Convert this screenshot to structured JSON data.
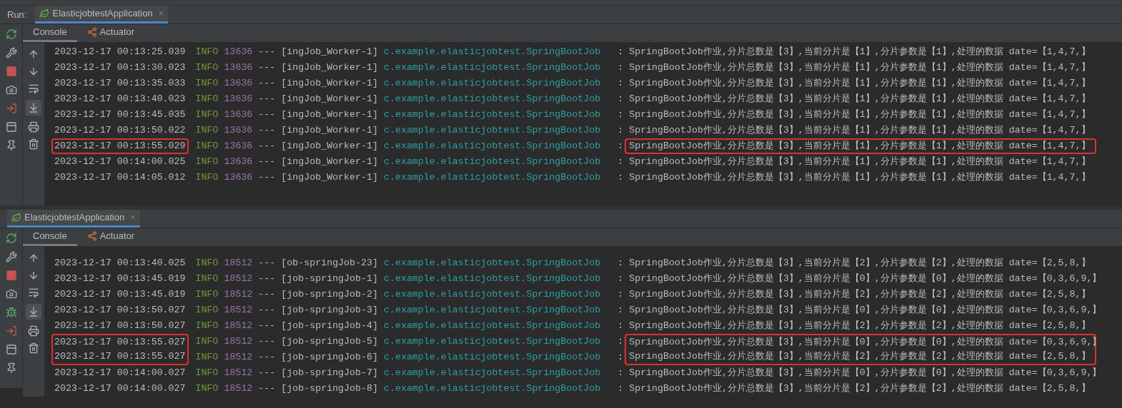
{
  "panels": [
    {
      "run_label": "Run:",
      "tab": {
        "title": "ElasticjobtestApplication",
        "close": "×",
        "selected": true
      },
      "subtabs": [
        {
          "label": "Console",
          "selected": true
        },
        {
          "label": "Actuator",
          "selected": false
        }
      ],
      "scroll_to_end": true,
      "rows": [
        {
          "time": "2023-12-17 00:13:25.039",
          "level": "INFO",
          "pid": "13636",
          "dashes": "---",
          "thread": "[ingJob_Worker-1]",
          "logger": "c.example.elasticjobtest.SpringBootJob",
          "sep": ":",
          "message": "SpringBootJob作业,分片总数是【3】,当前分片是【1】,分片参数是【1】,处理的数据 date=【1,4,7,】",
          "highlight": false
        },
        {
          "time": "2023-12-17 00:13:30.023",
          "level": "INFO",
          "pid": "13636",
          "dashes": "---",
          "thread": "[ingJob_Worker-1]",
          "logger": "c.example.elasticjobtest.SpringBootJob",
          "sep": ":",
          "message": "SpringBootJob作业,分片总数是【3】,当前分片是【1】,分片参数是【1】,处理的数据 date=【1,4,7,】",
          "highlight": false
        },
        {
          "time": "2023-12-17 00:13:35.033",
          "level": "INFO",
          "pid": "13636",
          "dashes": "---",
          "thread": "[ingJob_Worker-1]",
          "logger": "c.example.elasticjobtest.SpringBootJob",
          "sep": ":",
          "message": "SpringBootJob作业,分片总数是【3】,当前分片是【1】,分片参数是【1】,处理的数据 date=【1,4,7,】",
          "highlight": false
        },
        {
          "time": "2023-12-17 00:13:40.023",
          "level": "INFO",
          "pid": "13636",
          "dashes": "---",
          "thread": "[ingJob_Worker-1]",
          "logger": "c.example.elasticjobtest.SpringBootJob",
          "sep": ":",
          "message": "SpringBootJob作业,分片总数是【3】,当前分片是【1】,分片参数是【1】,处理的数据 date=【1,4,7,】",
          "highlight": false
        },
        {
          "time": "2023-12-17 00:13:45.035",
          "level": "INFO",
          "pid": "13636",
          "dashes": "---",
          "thread": "[ingJob_Worker-1]",
          "logger": "c.example.elasticjobtest.SpringBootJob",
          "sep": ":",
          "message": "SpringBootJob作业,分片总数是【3】,当前分片是【1】,分片参数是【1】,处理的数据 date=【1,4,7,】",
          "highlight": false
        },
        {
          "time": "2023-12-17 00:13:50.022",
          "level": "INFO",
          "pid": "13636",
          "dashes": "---",
          "thread": "[ingJob_Worker-1]",
          "logger": "c.example.elasticjobtest.SpringBootJob",
          "sep": ":",
          "message": "SpringBootJob作业,分片总数是【3】,当前分片是【1】,分片参数是【1】,处理的数据 date=【1,4,7,】",
          "highlight": false
        },
        {
          "time": "2023-12-17 00:13:55.029",
          "level": "INFO",
          "pid": "13636",
          "dashes": "---",
          "thread": "[ingJob_Worker-1]",
          "logger": "c.example.elasticjobtest.SpringBootJob",
          "sep": ":",
          "message": "SpringBootJob作业,分片总数是【3】,当前分片是【1】,分片参数是【1】,处理的数据 date=【1,4,7,】",
          "highlight": true
        },
        {
          "time": "2023-12-17 00:14:00.025",
          "level": "INFO",
          "pid": "13636",
          "dashes": "---",
          "thread": "[ingJob_Worker-1]",
          "logger": "c.example.elasticjobtest.SpringBootJob",
          "sep": ":",
          "message": "SpringBootJob作业,分片总数是【3】,当前分片是【1】,分片参数是【1】,处理的数据 date=【1,4,7,】",
          "highlight": false
        },
        {
          "time": "2023-12-17 00:14:05.012",
          "level": "INFO",
          "pid": "13636",
          "dashes": "---",
          "thread": "[ingJob_Worker-1]",
          "logger": "c.example.elasticjobtest.SpringBootJob",
          "sep": ":",
          "message": "SpringBootJob作业,分片总数是【3】,当前分片是【1】,分片参数是【1】,处理的数据 date=【1,4,7,】",
          "highlight": false
        }
      ]
    },
    {
      "tab": {
        "title": "ElasticjobtestApplication",
        "close": "×",
        "selected": true
      },
      "subtabs": [
        {
          "label": "Console",
          "selected": true
        },
        {
          "label": "Actuator",
          "selected": false
        }
      ],
      "scroll_to_end": true,
      "rows": [
        {
          "time": "2023-12-17 00:13:40.025",
          "level": "INFO",
          "pid": "18512",
          "dashes": "---",
          "thread": "[ob-springJob-23]",
          "logger": "c.example.elasticjobtest.SpringBootJob",
          "sep": ":",
          "message": "SpringBootJob作业,分片总数是【3】,当前分片是【2】,分片参数是【2】,处理的数据 date=【2,5,8,】",
          "highlight": false
        },
        {
          "time": "2023-12-17 00:13:45.019",
          "level": "INFO",
          "pid": "18512",
          "dashes": "---",
          "thread": "[job-springJob-1]",
          "logger": "c.example.elasticjobtest.SpringBootJob",
          "sep": ":",
          "message": "SpringBootJob作业,分片总数是【3】,当前分片是【0】,分片参数是【0】,处理的数据 date=【0,3,6,9,】",
          "highlight": false
        },
        {
          "time": "2023-12-17 00:13:45.019",
          "level": "INFO",
          "pid": "18512",
          "dashes": "---",
          "thread": "[job-springJob-2]",
          "logger": "c.example.elasticjobtest.SpringBootJob",
          "sep": ":",
          "message": "SpringBootJob作业,分片总数是【3】,当前分片是【2】,分片参数是【2】,处理的数据 date=【2,5,8,】",
          "highlight": false
        },
        {
          "time": "2023-12-17 00:13:50.027",
          "level": "INFO",
          "pid": "18512",
          "dashes": "---",
          "thread": "[job-springJob-3]",
          "logger": "c.example.elasticjobtest.SpringBootJob",
          "sep": ":",
          "message": "SpringBootJob作业,分片总数是【3】,当前分片是【0】,分片参数是【0】,处理的数据 date=【0,3,6,9,】",
          "highlight": false
        },
        {
          "time": "2023-12-17 00:13:50.027",
          "level": "INFO",
          "pid": "18512",
          "dashes": "---",
          "thread": "[job-springJob-4]",
          "logger": "c.example.elasticjobtest.SpringBootJob",
          "sep": ":",
          "message": "SpringBootJob作业,分片总数是【3】,当前分片是【2】,分片参数是【2】,处理的数据 date=【2,5,8,】",
          "highlight": false
        },
        {
          "time": "2023-12-17 00:13:55.027",
          "level": "INFO",
          "pid": "18512",
          "dashes": "---",
          "thread": "[job-springJob-5]",
          "logger": "c.example.elasticjobtest.SpringBootJob",
          "sep": ":",
          "message": "SpringBootJob作业,分片总数是【3】,当前分片是【0】,分片参数是【0】,处理的数据 date=【0,3,6,9,】",
          "highlight": true
        },
        {
          "time": "2023-12-17 00:13:55.027",
          "level": "INFO",
          "pid": "18512",
          "dashes": "---",
          "thread": "[job-springJob-6]",
          "logger": "c.example.elasticjobtest.SpringBootJob",
          "sep": ":",
          "message": "SpringBootJob作业,分片总数是【3】,当前分片是【2】,分片参数是【2】,处理的数据 date=【2,5,8,】",
          "highlight": true
        },
        {
          "time": "2023-12-17 00:14:00.027",
          "level": "INFO",
          "pid": "18512",
          "dashes": "---",
          "thread": "[job-springJob-7]",
          "logger": "c.example.elasticjobtest.SpringBootJob",
          "sep": ":",
          "message": "SpringBootJob作业,分片总数是【3】,当前分片是【0】,分片参数是【0】,处理的数据 date=【0,3,6,9,】",
          "highlight": false
        },
        {
          "time": "2023-12-17 00:14:00.027",
          "level": "INFO",
          "pid": "18512",
          "dashes": "---",
          "thread": "[job-springJob-8]",
          "logger": "c.example.elasticjobtest.SpringBootJob",
          "sep": ":",
          "message": "SpringBootJob作业,分片总数是【3】,当前分片是【2】,分片参数是【2】,处理的数据 date=【2,5,8,】",
          "highlight": false
        }
      ]
    }
  ]
}
